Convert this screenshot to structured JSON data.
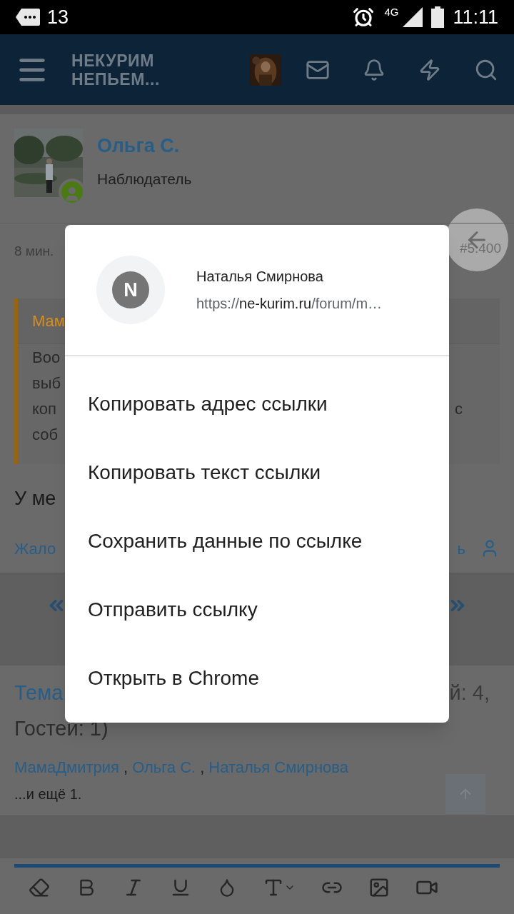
{
  "status_bar": {
    "notification_count": "13",
    "network": "4G",
    "time": "11:11"
  },
  "header": {
    "logo_lines": [
      "НЕКУРИМ",
      "НЕПЬЕМ..."
    ]
  },
  "post": {
    "author": "Ольга С.",
    "role": "Наблюдатель",
    "time": "8 мин.",
    "number": "#5.400",
    "quote_fragments": [
      {
        "kind": "author",
        "left": "Мам"
      },
      {
        "kind": "line",
        "left": "Воо"
      },
      {
        "kind": "line",
        "left": "выб"
      },
      {
        "kind": "line",
        "left": "коп",
        "right": "с"
      },
      {
        "kind": "line",
        "left": "соб"
      }
    ],
    "text_fragment": "У ме",
    "action_left": "Жало",
    "action_right": "ь"
  },
  "online": {
    "title_left": "Тема",
    "title_right": "й: 4,",
    "title_line2": "Гостей: 1)",
    "users": [
      "МамаДмитрия",
      "Ольга С.",
      "Наталья Смирнова"
    ],
    "separator": ",",
    "more": "...и ещё 1."
  },
  "dialog": {
    "avatar_letter": "N",
    "title": "Наталья Смирнова",
    "url": {
      "scheme": "https://",
      "host": "ne-kurim.ru",
      "path": "/forum/m…"
    },
    "items": [
      "Копировать адрес ссылки",
      "Копировать текст ссылки",
      "Сохранить данные по ссылке",
      "Отправить ссылку",
      "Открыть в Chrome"
    ]
  }
}
